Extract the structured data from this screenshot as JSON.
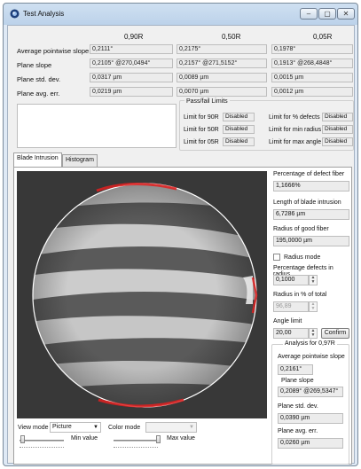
{
  "window": {
    "title": "Test Analysis",
    "buttons": [
      "minimize",
      "maximize",
      "close"
    ]
  },
  "columns": [
    "0,90R",
    "0,50R",
    "0,05R"
  ],
  "rows": [
    {
      "label": "Average pointwise slope",
      "values": [
        "0,2111°",
        "0,2175°",
        "0,1978°"
      ]
    },
    {
      "label": "Plane slope",
      "values": [
        "0,2105° @270,0494°",
        "0,2157° @271,5152°",
        "0,1913° @268,4848°"
      ]
    },
    {
      "label": "Plane std. dev.",
      "values": [
        "0,0317 µm",
        "0,0089 µm",
        "0,0015 µm"
      ]
    },
    {
      "label": "Plane avg. err.",
      "values": [
        "0,0219 µm",
        "0,0070 µm",
        "0,0012 µm"
      ]
    }
  ],
  "passfail": {
    "title": "Pass/fail Limits",
    "left": [
      {
        "label": "Limit for 90R",
        "value": "Disabled"
      },
      {
        "label": "Limit for 50R",
        "value": "Disabled"
      },
      {
        "label": "Limit for 05R",
        "value": "Disabled"
      }
    ],
    "right": [
      {
        "label": "Limit for % defects",
        "value": "Disabled"
      },
      {
        "label": "Limit for min radius",
        "value": "Disabled"
      },
      {
        "label": "Limit for max angle",
        "value": "Disabled"
      }
    ]
  },
  "tabs": [
    {
      "label": "Blade Intrusion",
      "active": true
    },
    {
      "label": "Histogram",
      "active": false
    }
  ],
  "right_panel": {
    "defect_label": "Percentage of defect fiber",
    "defect_value": "1,1666%",
    "intrusion_label": "Length of blade intrusion",
    "intrusion_value": "6,7286 µm",
    "radius_label": "Radius of good fiber",
    "radius_value": "195,0000 µm",
    "radius_mode_label": "Radius mode",
    "radius_mode_checked": false,
    "pct_defects_label": "Percentage defects in radius",
    "pct_defects_value": "0,1000",
    "radius_pct_label": "Radius in % of total",
    "radius_pct_value": "96,89",
    "angle_label": "Angle limit",
    "angle_value": "20,00",
    "confirm_label": "Confirm",
    "analysis_title": "Analysis for 0,97R",
    "avg_slope_label": "Average pointwise slope",
    "avg_slope_value": "0,2161°",
    "plane_slope_label": "Plane slope",
    "plane_slope_value": "0,2089° @269,5347°",
    "std_dev_label": "Plane std. dev.",
    "std_dev_value": "0,0390 µm",
    "avg_err_label": "Plane avg. err.",
    "avg_err_value": "0,0260 µm"
  },
  "bottom": {
    "view_mode_label": "View mode",
    "view_mode_value": "Picture",
    "color_mode_label": "Color mode",
    "color_mode_value": "",
    "min_value_label": "Min value",
    "max_value_label": "Max value"
  },
  "colors": {
    "accent": "#e02020",
    "circle": "#ffffff",
    "image_bg": "#3a3a3a"
  }
}
